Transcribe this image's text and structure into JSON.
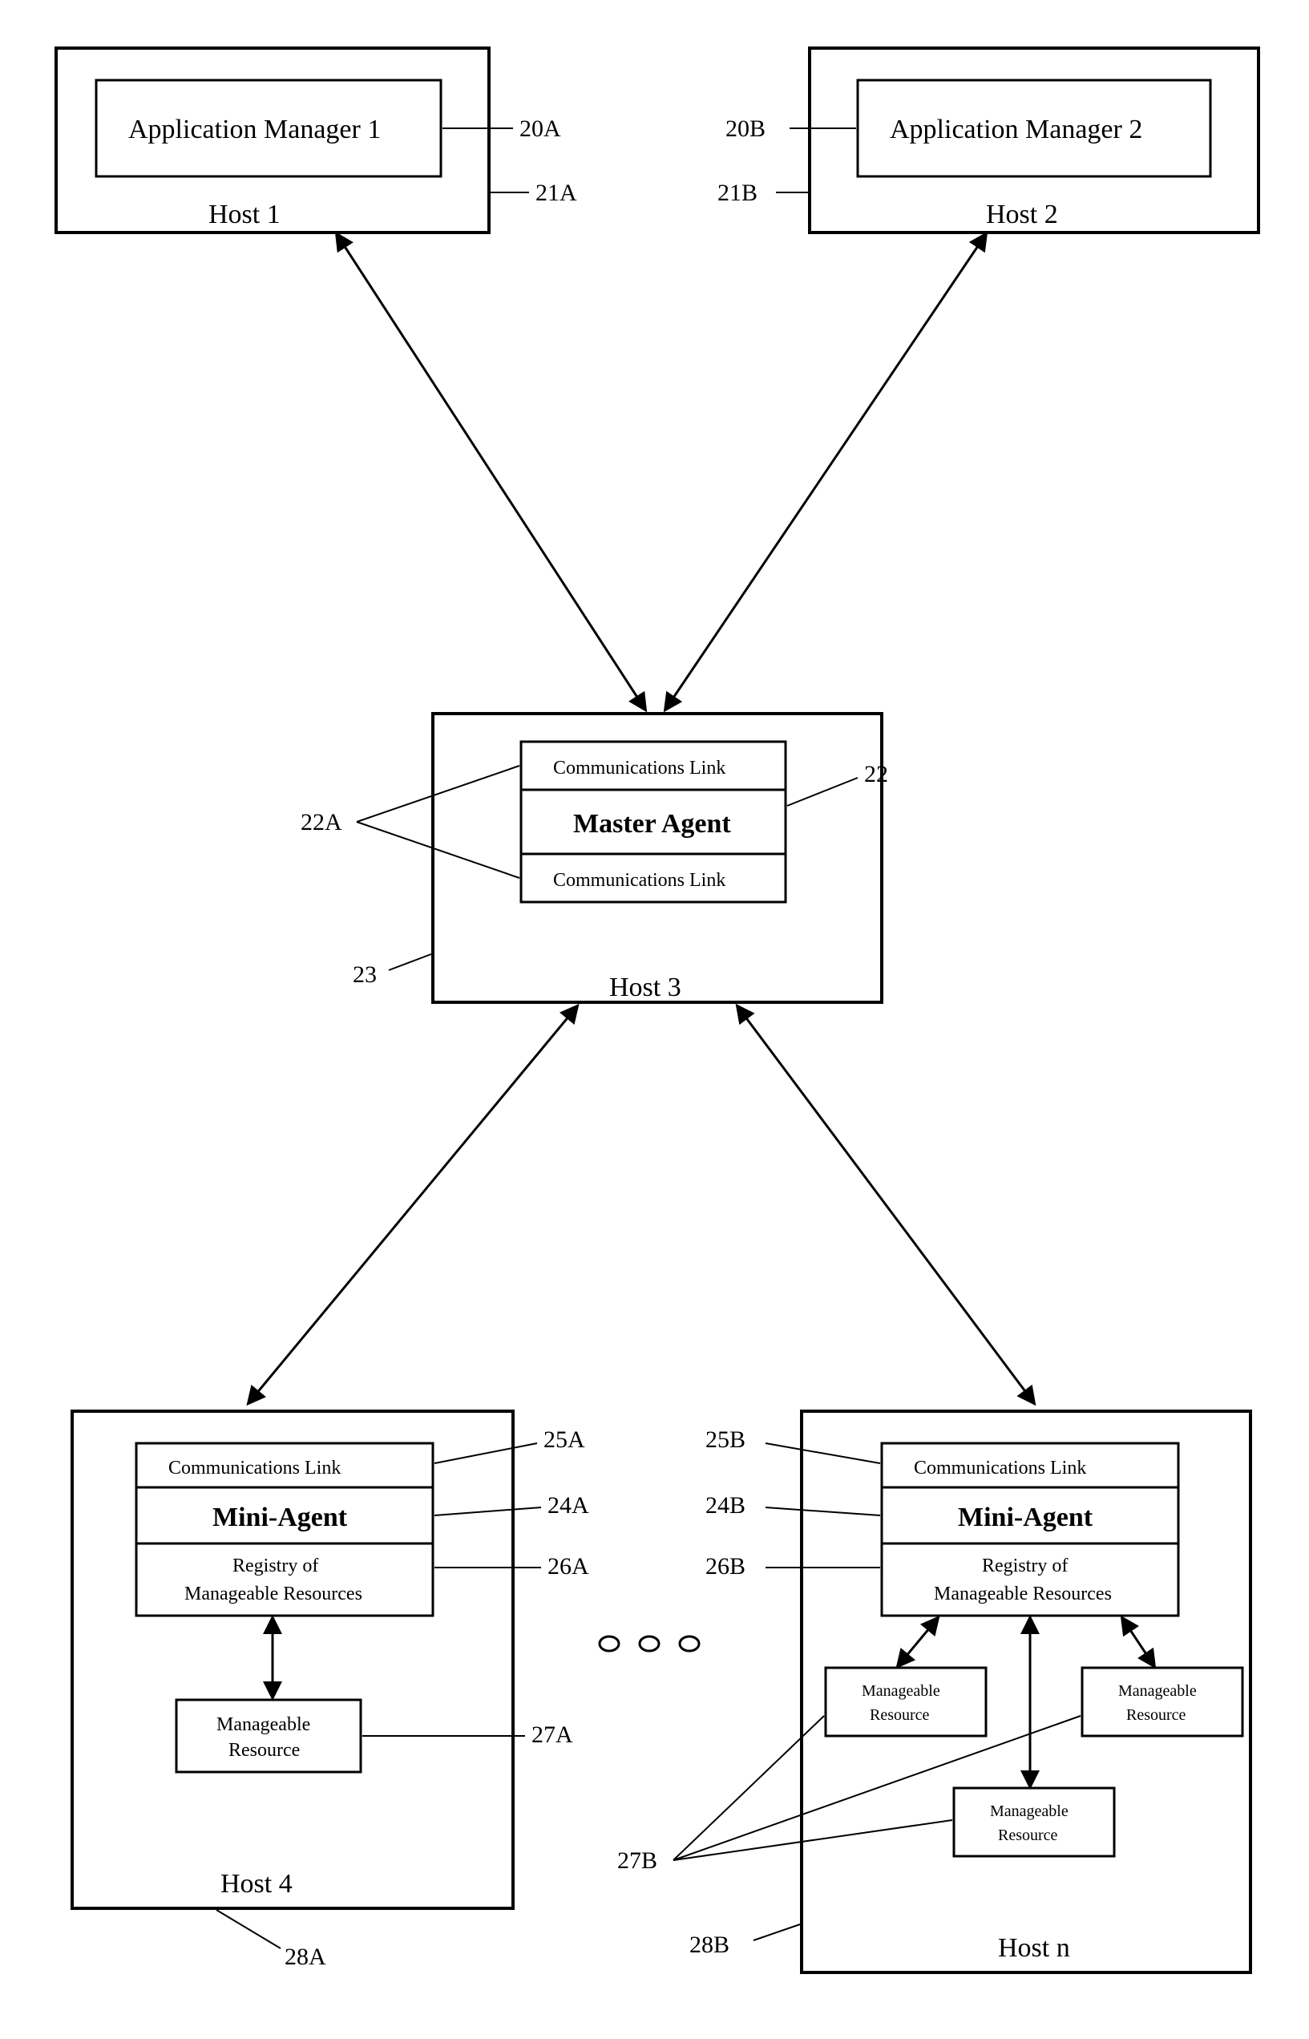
{
  "hosts": {
    "h1": {
      "label": "Host 1",
      "app": "Application Manager 1",
      "ref_app": "20A",
      "ref_host": "21A"
    },
    "h2": {
      "label": "Host 2",
      "app": "Application Manager 2",
      "ref_app": "20B",
      "ref_host": "21B"
    },
    "h3": {
      "label": "Host 3",
      "master": "Master Agent",
      "comm": "Communications Link",
      "ref_comm": "22A",
      "ref_master": "22",
      "ref_host": "23"
    },
    "h4": {
      "label": "Host 4",
      "mini": "Mini-Agent",
      "comm": "Communications Link",
      "reg1": "Registry of",
      "reg2": "Manageable Resources",
      "res1": "Manageable",
      "res2": "Resource",
      "ref_comm": "25A",
      "ref_mini": "24A",
      "ref_reg": "26A",
      "ref_res": "27A",
      "ref_host": "28A"
    },
    "hn": {
      "label": "Host n",
      "mini": "Mini-Agent",
      "comm": "Communications Link",
      "reg1": "Registry of",
      "reg2": "Manageable Resources",
      "res1": "Manageable",
      "res2": "Resource",
      "ref_comm": "25B",
      "ref_mini": "24B",
      "ref_reg": "26B",
      "ref_res": "27B",
      "ref_host": "28B"
    }
  }
}
